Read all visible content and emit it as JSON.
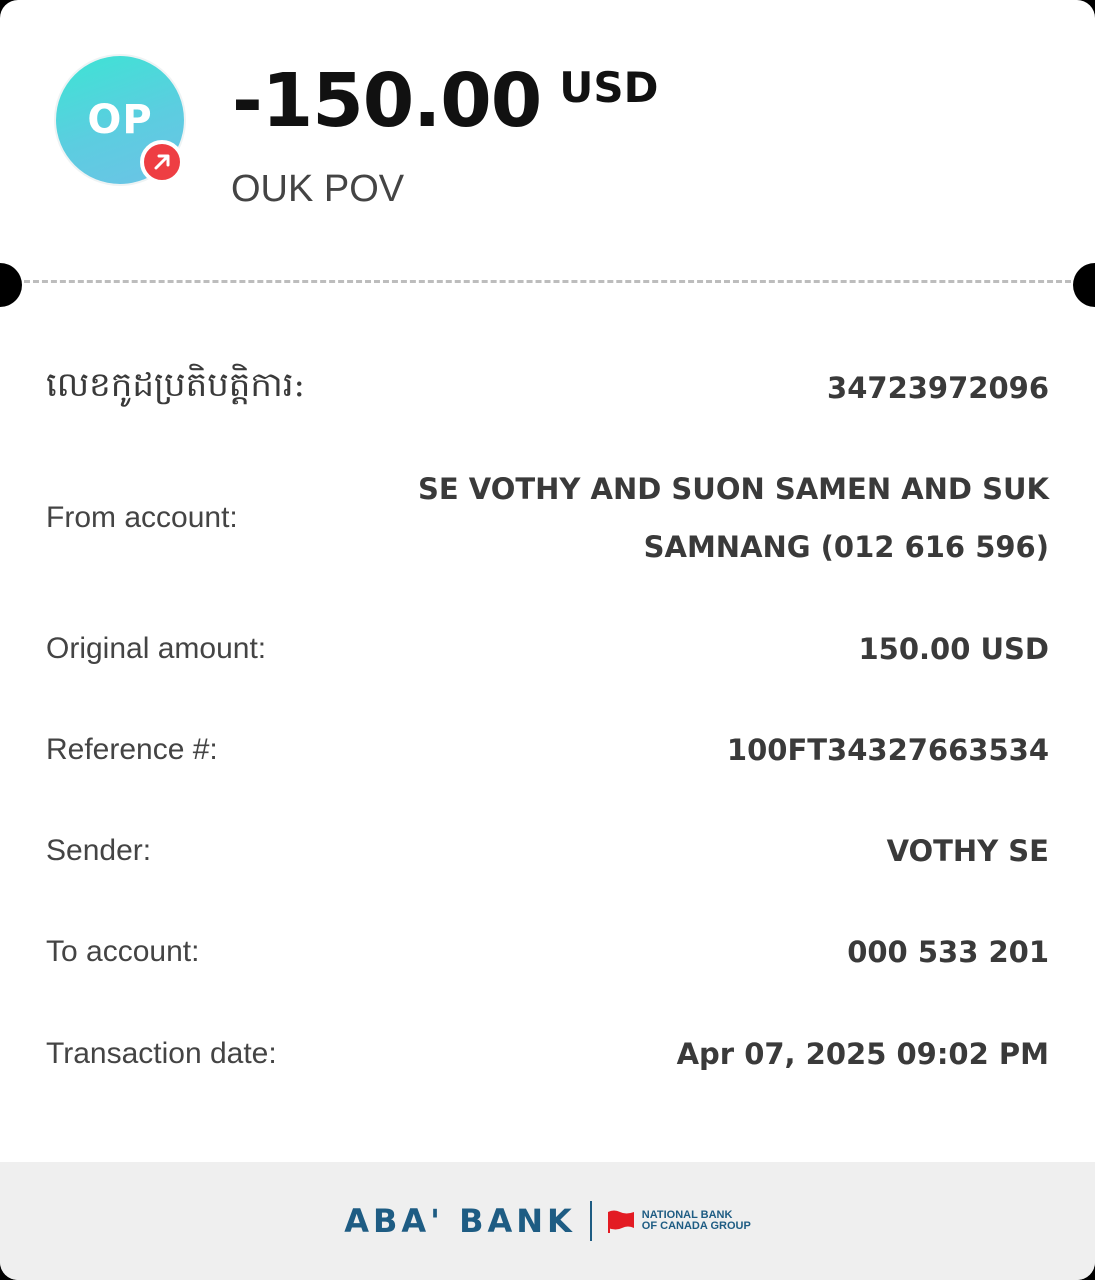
{
  "header": {
    "avatar_initials": "OP",
    "avatar_gradient": [
      "#3de4d4",
      "#6cc3e6"
    ],
    "badge_icon": "arrow-up-right-icon",
    "badge_color": "#ee3e43",
    "amount": "-150.00",
    "currency": "USD",
    "recipient_name": "OUK POV"
  },
  "details": [
    {
      "label": "លេខកូដប្រតិបត្តិការ:",
      "value": "34723972096"
    },
    {
      "label": "From account:",
      "value": "SE VOTHY AND SUON SAMEN AND SUK SAMNANG (012 616 596)"
    },
    {
      "label": "Original amount:",
      "value": "150.00 USD"
    },
    {
      "label": "Reference #:",
      "value": "100FT34327663534"
    },
    {
      "label": "Sender:",
      "value": "VOTHY SE"
    },
    {
      "label": "To account:",
      "value": "000 533 201"
    },
    {
      "label": "Transaction date:",
      "value": "Apr 07, 2025 09:02 PM"
    }
  ],
  "footer": {
    "brand_name": "ABA' BANK",
    "brand_color": "#1e5c83",
    "partner_logo_icon": "national-bank-flag-icon",
    "partner_line1": "NATIONAL BANK",
    "partner_line2": "OF CANADA GROUP"
  }
}
